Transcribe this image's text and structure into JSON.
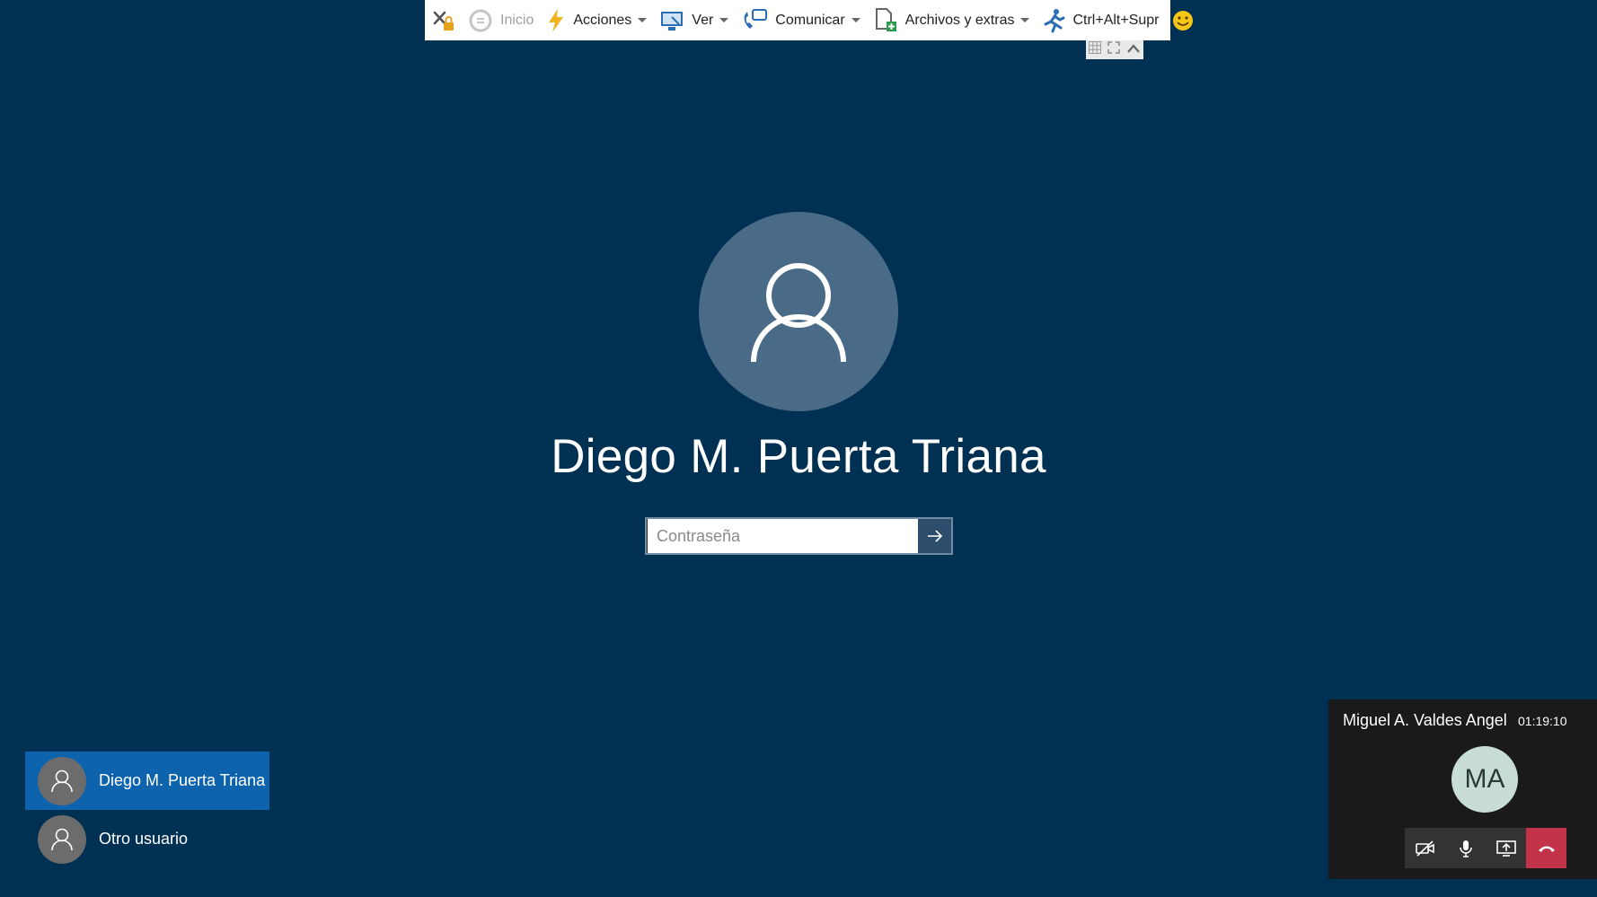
{
  "toolbar": {
    "items": [
      {
        "icon": "disconnect-lock-icon",
        "label": ""
      },
      {
        "icon": "refresh-icon",
        "label": "Inicio",
        "disabled": true
      },
      {
        "icon": "lightning-icon",
        "label": "Acciones"
      },
      {
        "icon": "monitor-icon",
        "label": "Ver"
      },
      {
        "icon": "phone-chat-icon",
        "label": "Comunicar"
      },
      {
        "icon": "file-icon",
        "label": "Archivos y extras"
      },
      {
        "icon": "running-man-icon",
        "label": "Ctrl+Alt+Supr"
      },
      {
        "icon": "smiley-icon",
        "label": ""
      }
    ],
    "sub_icons": [
      "grid-icon",
      "fullscreen-icon",
      "collapse-icon"
    ]
  },
  "login": {
    "user_name": "Diego M. Puerta Triana",
    "password_placeholder": "Contraseña"
  },
  "user_list": [
    {
      "name": "Diego M. Puerta Triana",
      "selected": true
    },
    {
      "name": "Otro usuario",
      "selected": false
    }
  ],
  "call": {
    "caller_name": "Miguel A. Valdes Angel",
    "duration": "01:19:10",
    "initials": "MA",
    "controls": [
      "video-off-icon",
      "microphone-icon",
      "share-screen-icon",
      "hang-up-icon"
    ]
  },
  "colors": {
    "background": "#003152",
    "selected_user": "#0e63ad",
    "hang_up": "#c2334a",
    "avatar_circle": "#4a6b87"
  }
}
